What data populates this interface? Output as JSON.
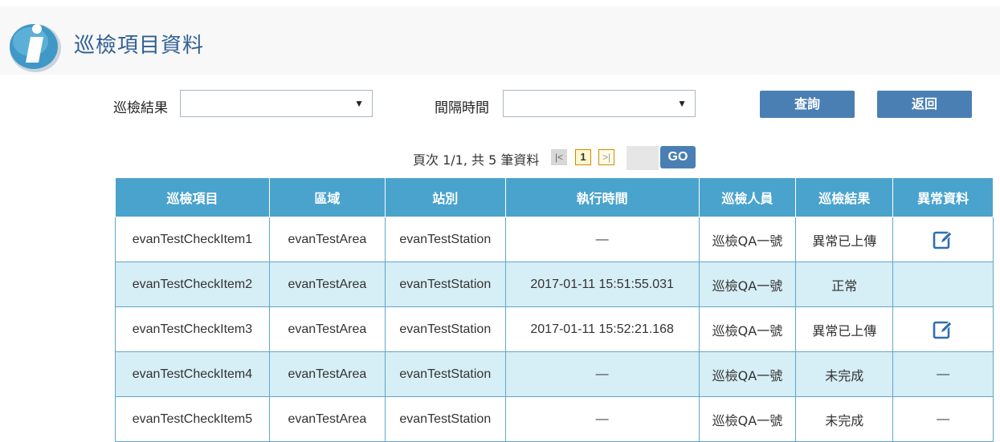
{
  "header": {
    "title": "巡檢項目資料"
  },
  "filters": {
    "result_label": "巡檢結果",
    "result_value": "",
    "interval_label": "間隔時間",
    "interval_value": "",
    "query_button": "查詢",
    "back_button": "返回"
  },
  "pager": {
    "summary": "頁次 1/1, 共 5 筆資料",
    "first": "|<",
    "current_page": "1",
    "last": ">|",
    "goto_value": "",
    "go_button": "GO"
  },
  "table": {
    "columns": [
      "巡檢項目",
      "區域",
      "站別",
      "執行時間",
      "巡檢人員",
      "巡檢結果",
      "異常資料"
    ],
    "rows": [
      {
        "item": "evanTestCheckItem1",
        "area": "evanTestArea",
        "station": "evanTestStation",
        "time": "—",
        "inspector": "巡檢QA一號",
        "result": "異常已上傳",
        "abnormal": "edit-icon"
      },
      {
        "item": "evanTestCheckItem2",
        "area": "evanTestArea",
        "station": "evanTestStation",
        "time": "2017-01-11 15:51:55.031",
        "inspector": "巡檢QA一號",
        "result": "正常",
        "abnormal": ""
      },
      {
        "item": "evanTestCheckItem3",
        "area": "evanTestArea",
        "station": "evanTestStation",
        "time": "2017-01-11 15:52:21.168",
        "inspector": "巡檢QA一號",
        "result": "異常已上傳",
        "abnormal": "edit-icon"
      },
      {
        "item": "evanTestCheckItem4",
        "area": "evanTestArea",
        "station": "evanTestStation",
        "time": "—",
        "inspector": "巡檢QA一號",
        "result": "未完成",
        "abnormal": "—"
      },
      {
        "item": "evanTestCheckItem5",
        "area": "evanTestArea",
        "station": "evanTestStation",
        "time": "—",
        "inspector": "巡檢QA一號",
        "result": "未完成",
        "abnormal": "—"
      }
    ]
  },
  "colors": {
    "title": "#2f5f93",
    "header_bg": "#4aa3cc",
    "row_alt_bg": "#d6eef5",
    "button_bg": "#4a7fb3",
    "icon": "#2f6fb0"
  }
}
